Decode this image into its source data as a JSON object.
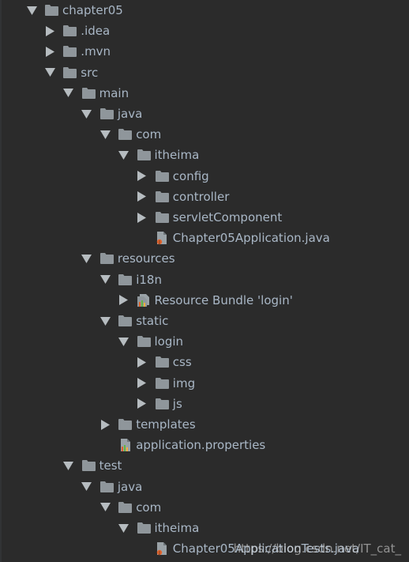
{
  "colors": {
    "background": "#2b2b2b",
    "text": "#a9b7c6",
    "folder": "#8f969b",
    "arrow": "#b6bcc0"
  },
  "tree": [
    {
      "label": "chapter05",
      "depth": 0,
      "expanded": true,
      "icon": "folder-icon"
    },
    {
      "label": ".idea",
      "depth": 1,
      "expanded": false,
      "icon": "folder-icon"
    },
    {
      "label": ".mvn",
      "depth": 1,
      "expanded": false,
      "icon": "folder-icon"
    },
    {
      "label": "src",
      "depth": 1,
      "expanded": true,
      "icon": "folder-icon"
    },
    {
      "label": "main",
      "depth": 2,
      "expanded": true,
      "icon": "folder-icon"
    },
    {
      "label": "java",
      "depth": 3,
      "expanded": true,
      "icon": "folder-icon"
    },
    {
      "label": "com",
      "depth": 4,
      "expanded": true,
      "icon": "folder-icon"
    },
    {
      "label": "itheima",
      "depth": 5,
      "expanded": true,
      "icon": "folder-icon"
    },
    {
      "label": "config",
      "depth": 6,
      "expanded": false,
      "icon": "folder-icon"
    },
    {
      "label": "controller",
      "depth": 6,
      "expanded": false,
      "icon": "folder-icon"
    },
    {
      "label": "servletComponent",
      "depth": 6,
      "expanded": false,
      "icon": "folder-icon"
    },
    {
      "label": "Chapter05Application.java",
      "depth": 6,
      "expanded": null,
      "icon": "java-file-icon"
    },
    {
      "label": "resources",
      "depth": 3,
      "expanded": true,
      "icon": "folder-icon"
    },
    {
      "label": "i18n",
      "depth": 4,
      "expanded": true,
      "icon": "folder-icon"
    },
    {
      "label": "Resource Bundle 'login'",
      "depth": 5,
      "expanded": false,
      "icon": "resource-bundle-icon"
    },
    {
      "label": "static",
      "depth": 4,
      "expanded": true,
      "icon": "folder-icon"
    },
    {
      "label": "login",
      "depth": 5,
      "expanded": true,
      "icon": "folder-icon"
    },
    {
      "label": "css",
      "depth": 6,
      "expanded": false,
      "icon": "folder-icon"
    },
    {
      "label": "img",
      "depth": 6,
      "expanded": false,
      "icon": "folder-icon"
    },
    {
      "label": "js",
      "depth": 6,
      "expanded": false,
      "icon": "folder-icon"
    },
    {
      "label": "templates",
      "depth": 4,
      "expanded": false,
      "icon": "folder-icon"
    },
    {
      "label": "application.properties",
      "depth": 4,
      "expanded": null,
      "icon": "properties-file-icon"
    },
    {
      "label": "test",
      "depth": 2,
      "expanded": true,
      "icon": "folder-icon"
    },
    {
      "label": "java",
      "depth": 3,
      "expanded": true,
      "icon": "folder-icon"
    },
    {
      "label": "com",
      "depth": 4,
      "expanded": true,
      "icon": "folder-icon"
    },
    {
      "label": "itheima",
      "depth": 5,
      "expanded": true,
      "icon": "folder-icon"
    },
    {
      "label": "Chapter05ApplicationTests.java",
      "depth": 6,
      "expanded": null,
      "icon": "java-file-icon"
    }
  ],
  "watermark": "https://blog.csdn.net/IT_cat_"
}
